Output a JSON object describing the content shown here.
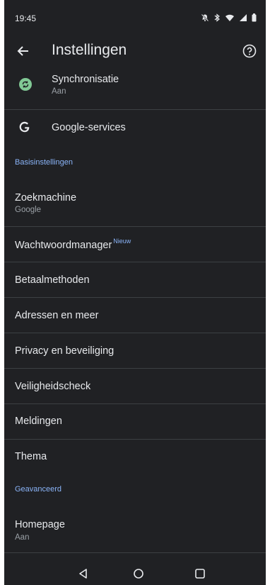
{
  "status_bar": {
    "time": "19:45"
  },
  "app_bar": {
    "title": "Instellingen"
  },
  "account": {
    "sync_label": "Synchronisatie",
    "sync_status": "Aan",
    "google_services": "Google-services"
  },
  "sections": {
    "basic": "Basisinstellingen",
    "advanced": "Geavanceerd"
  },
  "items": {
    "search_engine": {
      "label": "Zoekmachine",
      "value": "Google"
    },
    "password_manager": {
      "label": "Wachtwoordmanager",
      "badge": "Nieuw"
    },
    "payment_methods": {
      "label": "Betaalmethoden"
    },
    "addresses": {
      "label": "Adressen en meer"
    },
    "privacy": {
      "label": "Privacy en beveiliging"
    },
    "safety_check": {
      "label": "Veiligheidscheck"
    },
    "notifications": {
      "label": "Meldingen"
    },
    "theme": {
      "label": "Thema"
    },
    "homepage": {
      "label": "Homepage",
      "value": "Aan"
    }
  },
  "colors": {
    "background": "#202124",
    "accent": "#8ab4f8",
    "sync_green": "#81c995"
  }
}
